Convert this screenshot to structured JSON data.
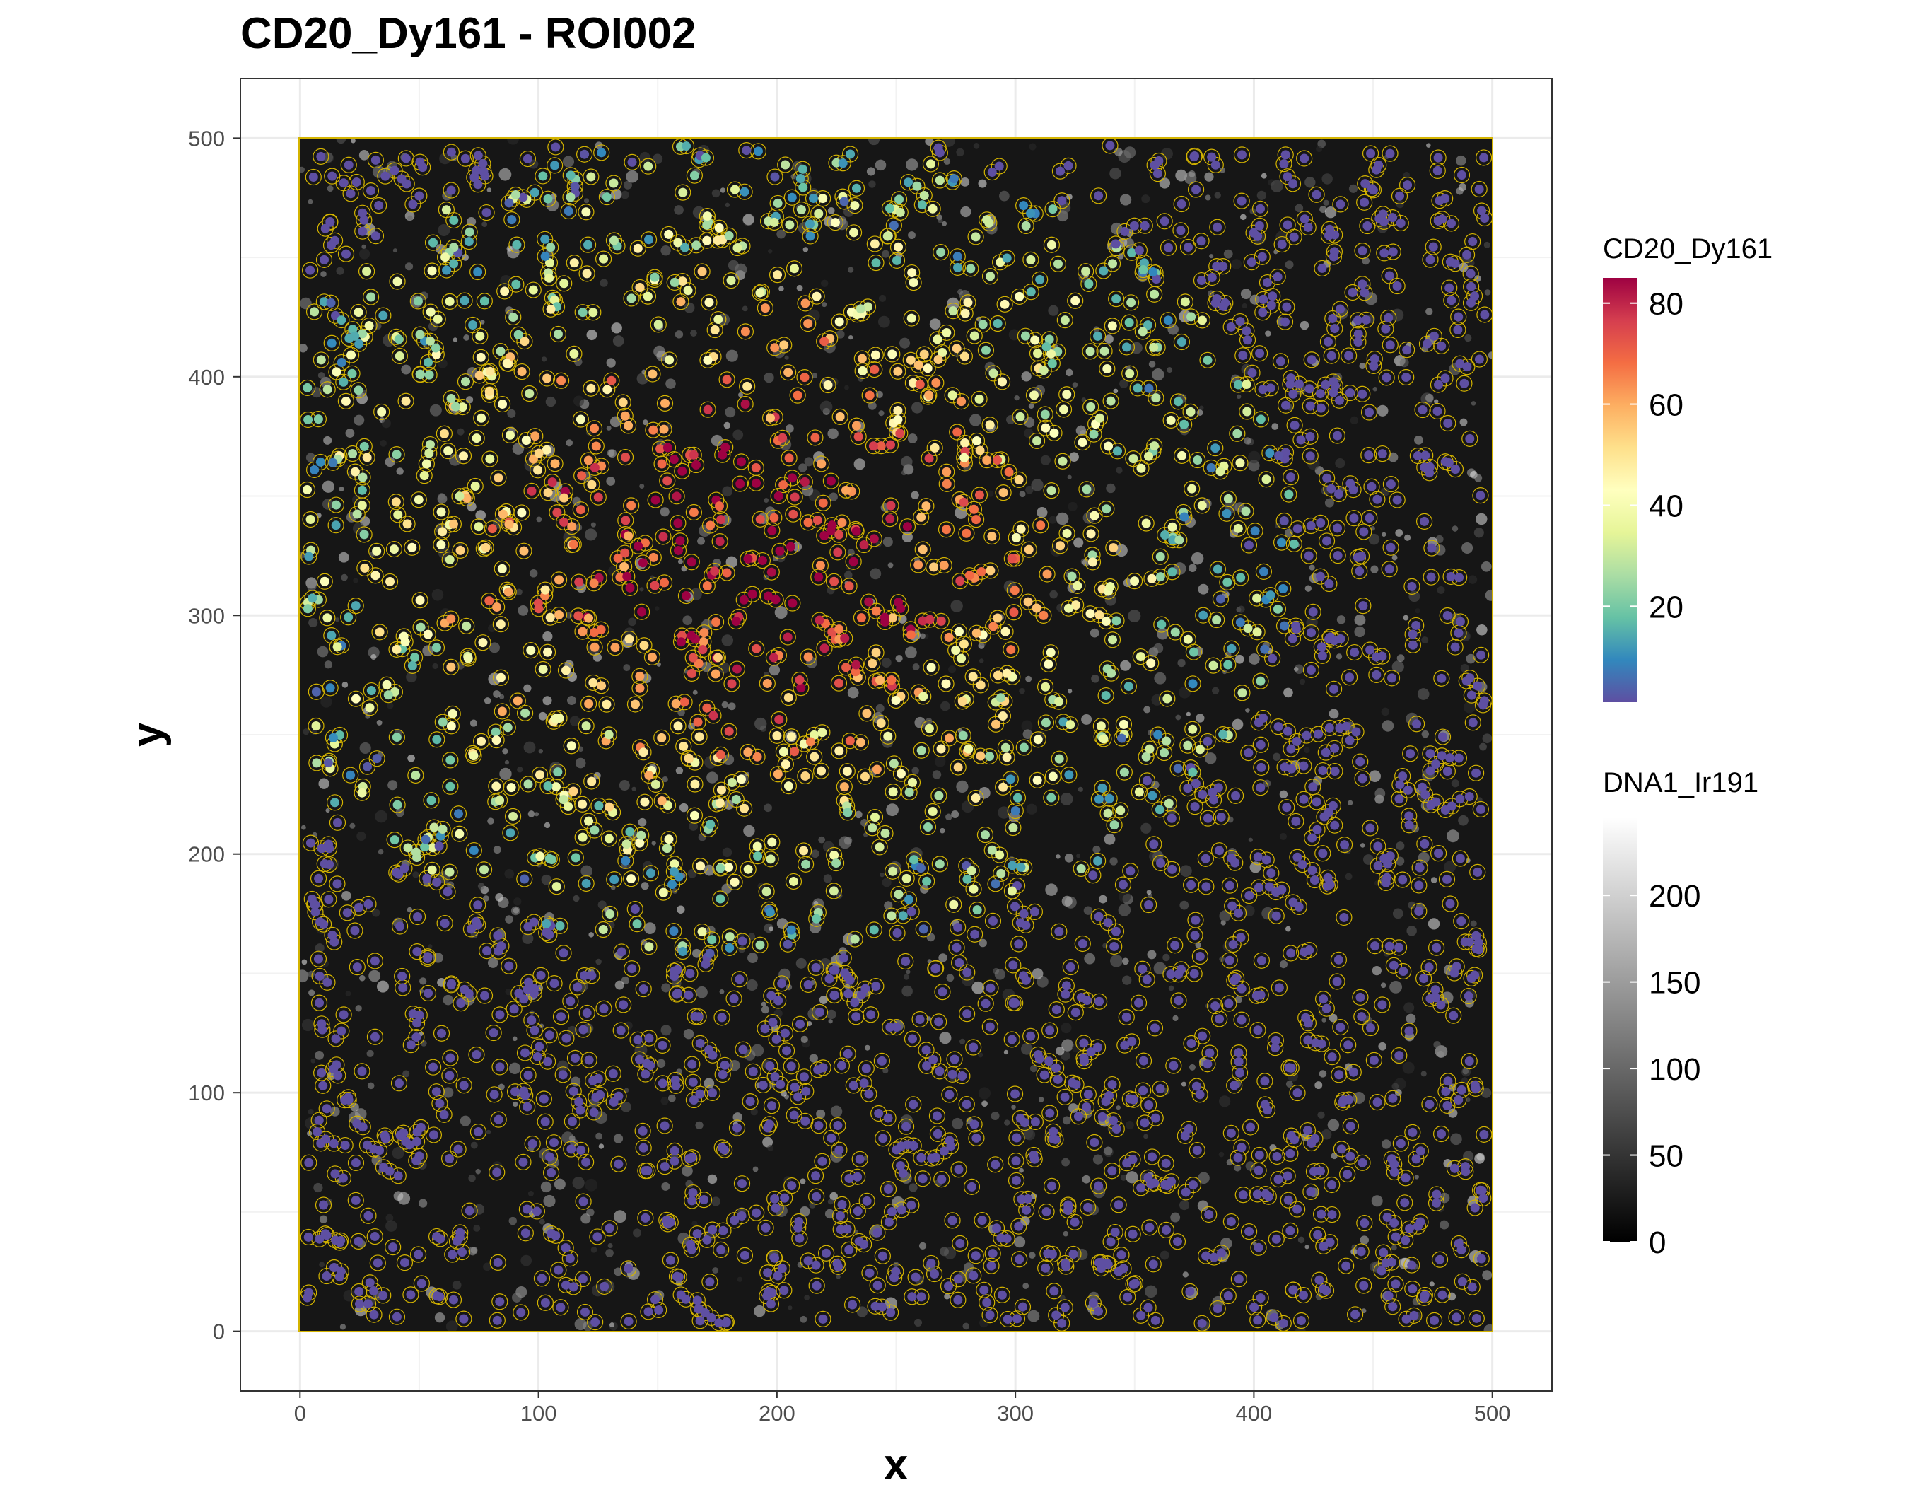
{
  "chart_data": {
    "type": "scatter",
    "title": "CD20_Dy161 - ROI002",
    "xlabel": "x",
    "ylabel": "y",
    "xlim": [
      -25,
      525
    ],
    "ylim": [
      525,
      -25
    ],
    "x_ticks": [
      0,
      100,
      200,
      300,
      400,
      500
    ],
    "y_ticks": [
      0,
      100,
      200,
      300,
      400,
      500
    ],
    "grid": true,
    "background_image": {
      "channel": "DNA1_Ir191",
      "extent": [
        0,
        500,
        0,
        500
      ],
      "colormap": "greyscale"
    },
    "cell_outline_color": "#d4b400",
    "color_legend": {
      "title": "CD20_Dy161",
      "ticks": [
        20,
        40,
        60,
        80
      ],
      "range": [
        1,
        85
      ],
      "colors": [
        "#5e4fa2",
        "#3288bd",
        "#66c2a5",
        "#abdda4",
        "#e6f598",
        "#ffffbf",
        "#fee08b",
        "#fdae61",
        "#f46d43",
        "#d53e4f",
        "#9e0142"
      ]
    },
    "image_legend": {
      "title": "DNA1_Ir191",
      "ticks": [
        0,
        50,
        100,
        150,
        200
      ],
      "range": [
        0,
        245
      ],
      "colors": [
        "#000000",
        "#ffffff"
      ]
    },
    "legend_position": "right"
  }
}
